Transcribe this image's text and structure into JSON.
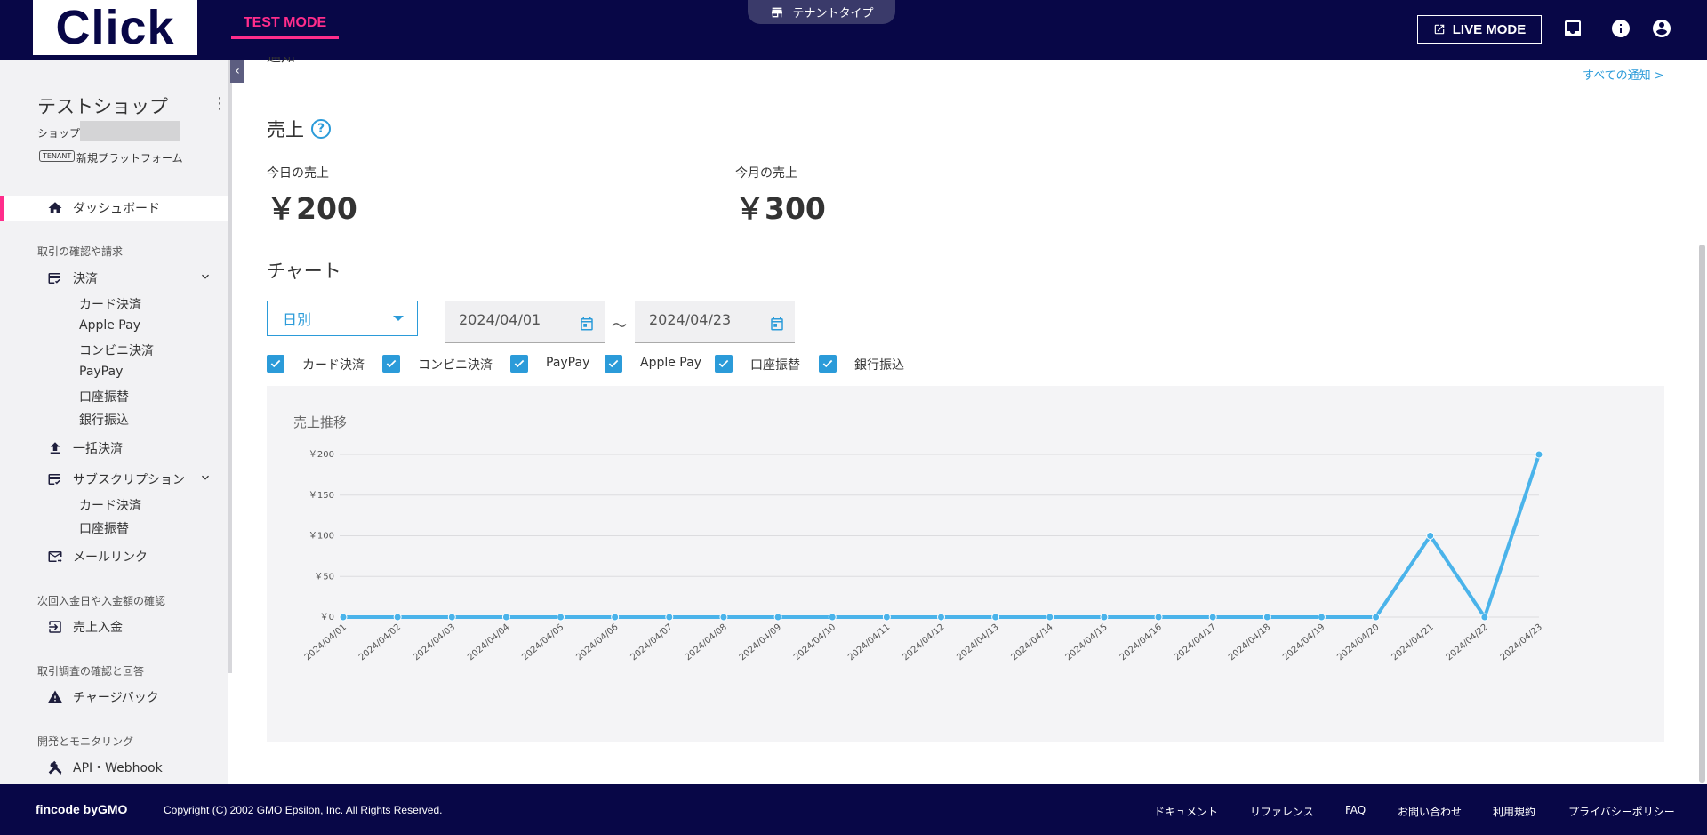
{
  "header": {
    "logo": "Click",
    "mode": "TEST MODE",
    "tenant_type": "テナントタイプ",
    "live_mode": "LIVE MODE"
  },
  "sidebar": {
    "shop_name": "テストショップ",
    "shop_id_label": "ショップ",
    "tenant_badge": "TENANT",
    "tenant_name": "新規プラットフォーム",
    "dashboard": "ダッシュボード",
    "section_transactions": "取引の確認や請求",
    "payments": "決済",
    "payment_items": [
      "カード決済",
      "Apple Pay",
      "コンビニ決済",
      "PayPay",
      "口座振替",
      "銀行振込"
    ],
    "bulk_payment": "一括決済",
    "subscription": "サブスクリプション",
    "subscription_items": [
      "カード決済",
      "口座振替"
    ],
    "mail_link": "メールリンク",
    "section_deposit": "次回入金日や入金額の確認",
    "sales_deposit": "売上入金",
    "section_dispute": "取引調査の確認と回答",
    "chargeback": "チャージバック",
    "section_dev": "開発とモニタリング",
    "api_webhook": "API・Webhook"
  },
  "main": {
    "cut_title": "通知",
    "all_notices": "すべての通知 >",
    "sales_title": "売上",
    "today_label": "今日の売上",
    "today_value": "￥200",
    "month_label": "今月の売上",
    "month_value": "￥300",
    "chart_section_title": "チャート",
    "period_select": "日別",
    "date_from": "2024/04/01",
    "date_sep": "〜",
    "date_to": "2024/04/23",
    "filters": [
      "カード決済",
      "コンビニ決済",
      "PayPay",
      "Apple Pay",
      "口座振替",
      "銀行振込"
    ],
    "chart_title": "売上推移"
  },
  "chart_data": {
    "type": "line",
    "title": "売上推移",
    "categories": [
      "2024/04/01",
      "2024/04/02",
      "2024/04/03",
      "2024/04/04",
      "2024/04/05",
      "2024/04/06",
      "2024/04/07",
      "2024/04/08",
      "2024/04/09",
      "2024/04/10",
      "2024/04/11",
      "2024/04/12",
      "2024/04/13",
      "2024/04/14",
      "2024/04/15",
      "2024/04/16",
      "2024/04/17",
      "2024/04/18",
      "2024/04/19",
      "2024/04/20",
      "2024/04/21",
      "2024/04/22",
      "2024/04/23"
    ],
    "values": [
      0,
      0,
      0,
      0,
      0,
      0,
      0,
      0,
      0,
      0,
      0,
      0,
      0,
      0,
      0,
      0,
      0,
      0,
      0,
      0,
      100,
      0,
      200
    ],
    "yticks": [
      "￥0",
      "￥50",
      "￥100",
      "￥150",
      "￥200"
    ],
    "ylim": [
      0,
      200
    ],
    "grid": true,
    "color": "#4ab3ea"
  },
  "footer": {
    "brand": "fincode byGMO",
    "copyright": "Copyright (C) 2002 GMO Epsilon, Inc. All Rights Reserved.",
    "links": [
      "ドキュメント",
      "リファレンス",
      "FAQ",
      "お問い合わせ",
      "利用規約",
      "プライバシーポリシー"
    ]
  }
}
